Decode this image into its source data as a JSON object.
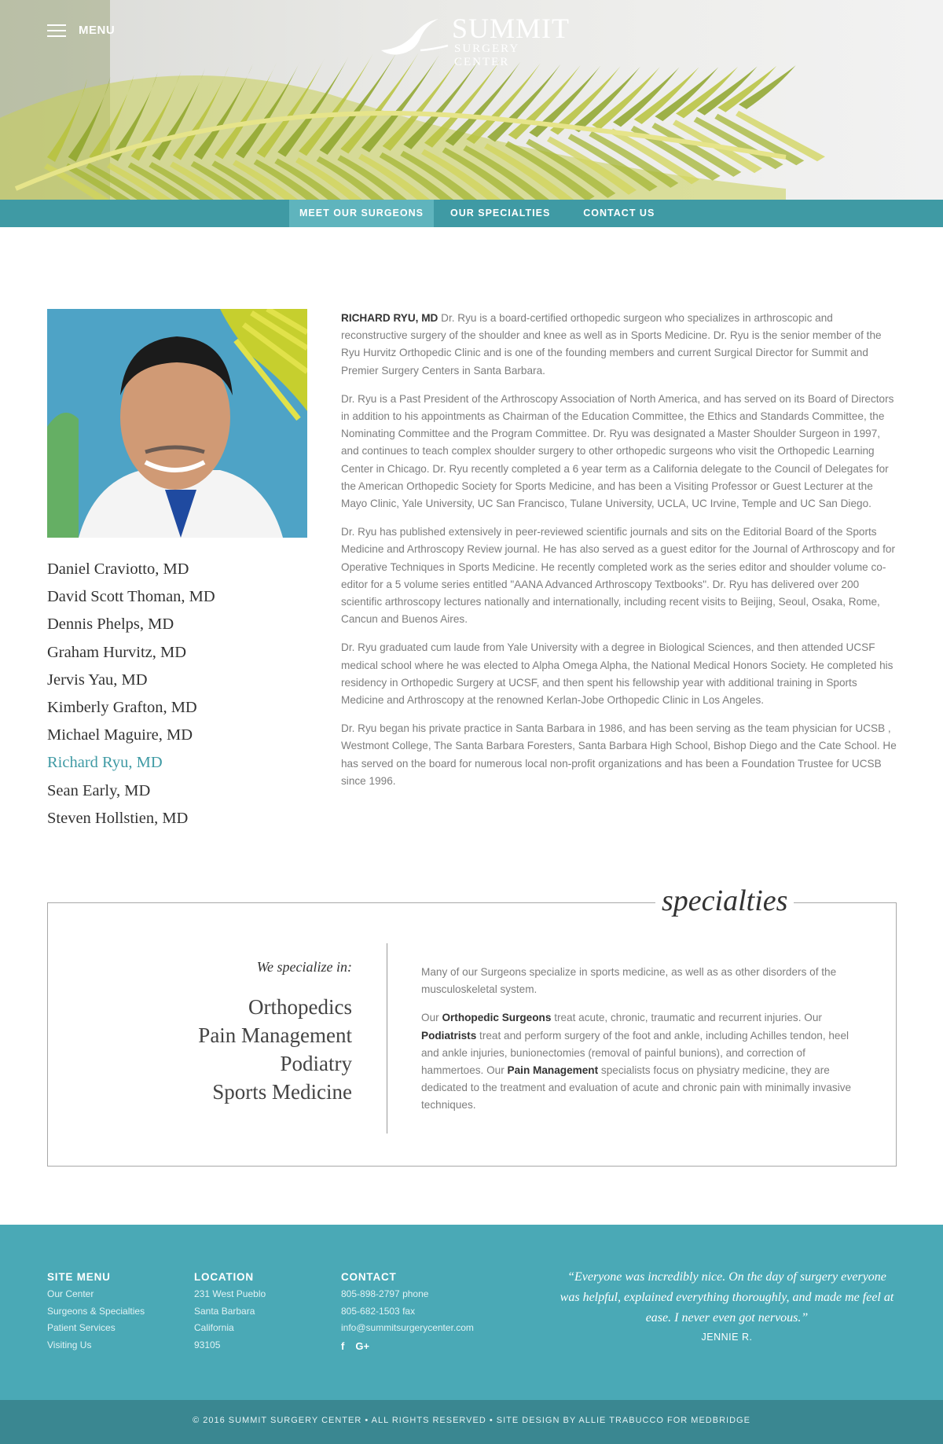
{
  "header": {
    "menu_label": "MENU",
    "logo_title": "SUMMIT",
    "logo_subtitle": "SURGERY CENTER"
  },
  "nav": {
    "items": [
      {
        "label": "MEET OUR SURGEONS",
        "active": true
      },
      {
        "label": "OUR SPECIALTIES",
        "active": false
      },
      {
        "label": "CONTACT US",
        "active": false
      }
    ]
  },
  "surgeons": {
    "list": [
      "Daniel Craviotto, MD",
      "David Scott Thoman, MD",
      "Dennis Phelps, MD",
      "Graham Hurvitz, MD",
      "Jervis Yau, MD",
      "Kimberly Grafton, MD",
      "Michael Maguire, MD",
      "Richard Ryu, MD",
      "Sean Early, MD",
      "Steven Hollstien, MD"
    ],
    "selected": "Richard Ryu, MD"
  },
  "bio": {
    "name": "RICHARD RYU, MD",
    "p1_rest": " Dr. Ryu is a board-certified orthopedic surgeon who specializes in arthroscopic and reconstructive surgery of the shoulder and knee as well as in Sports Medicine. Dr. Ryu is the senior member of the Ryu Hurvitz Orthopedic Clinic and is one of the founding members and current Surgical Director for Summit and Premier Surgery Centers in Santa Barbara.",
    "p2": "Dr. Ryu is a Past President of the Arthroscopy Association of North America, and has served on its Board of Directors in addition to his appointments as Chairman of the Education Committee, the Ethics and Standards Committee, the Nominating Committee and the Program Committee. Dr. Ryu was designated a Master Shoulder Surgeon in 1997, and continues to teach complex shoulder surgery to other orthopedic surgeons who visit the Orthopedic Learning Center in Chicago. Dr. Ryu recently completed a 6 year term as a California delegate to the Council of Delegates for the American Orthopedic Society for Sports Medicine, and has been a Visiting Professor or Guest Lecturer at the Mayo Clinic, Yale University, UC San Francisco, Tulane University, UCLA, UC Irvine, Temple and UC San Diego.",
    "p3": "Dr. Ryu has published extensively in peer-reviewed scientific journals and sits on the Editorial Board of the Sports Medicine and Arthroscopy Review journal. He has also served as a guest editor for the Journal of Arthroscopy and for Operative Techniques in Sports Medicine. He recently completed work as the series editor and shoulder volume co-editor for a 5 volume series entitled \"AANA Advanced Arthroscopy Textbooks\". Dr. Ryu has delivered over 200 scientific arthroscopy lectures nationally and internationally, including recent visits to Beijing, Seoul, Osaka, Rome, Cancun and Buenos Aires.",
    "p4": "Dr. Ryu graduated cum laude from Yale University with a degree in Biological Sciences, and then attended UCSF medical school where he was elected to Alpha Omega Alpha, the National Medical Honors Society. He completed his residency in Orthopedic Surgery at UCSF, and then spent his fellowship year with additional training in Sports Medicine and Arthroscopy at the renowned Kerlan-Jobe Orthopedic Clinic in Los Angeles.",
    "p5": "Dr. Ryu began his private practice in Santa Barbara in 1986, and has been serving as the team physician for UCSB , Westmont College, The Santa Barbara Foresters, Santa Barbara High School, Bishop Diego and the Cate School. He has served on the board for numerous local non-profit organizations and has been a Foundation Trustee for UCSB since 1996."
  },
  "specialties": {
    "heading": "specialties",
    "intro_label": "We specialize in:",
    "items": [
      "Orthopedics",
      "Pain Management",
      "Podiatry",
      "Sports Medicine"
    ],
    "p1": "Many of our Surgeons specialize in sports medicine, as well as as other disorders of the musculoskeletal system.",
    "p2_a": "Our ",
    "p2_b": "Orthopedic Surgeons",
    "p2_c": " treat acute, chronic, traumatic and recurrent injuries. Our ",
    "p2_d": "Podiatrists",
    "p2_e": " treat and perform surgery of the foot and ankle, including Achilles tendon, heel and ankle injuries, bunionectomies (removal of painful bunions), and correction of hammertoes. Our ",
    "p2_f": "Pain Management",
    "p2_g": " specialists focus on physiatry medicine, they are dedicated to the treatment and evaluation of acute and chronic pain with minimally invasive techniques."
  },
  "footer": {
    "site_menu": {
      "heading": "SITE MENU",
      "links": [
        "Our Center",
        "Surgeons & Specialties",
        "Patient Services",
        "Visiting Us"
      ]
    },
    "location": {
      "heading": "LOCATION",
      "lines": [
        "231 West Pueblo",
        "Santa Barbara",
        "California",
        "93105"
      ]
    },
    "contact": {
      "heading": "CONTACT",
      "lines": [
        "805-898-2797 phone",
        "805-682-1503 fax",
        "info@summitsurgerycenter.com"
      ],
      "social": [
        {
          "icon": "facebook-icon",
          "glyph": "f"
        },
        {
          "icon": "google-plus-icon",
          "glyph": "G+"
        }
      ]
    },
    "quote": "“Everyone was incredibly nice. On the day of surgery everyone was helpful, explained everything thoroughly, and made me feel at ease. I never even got nervous.”",
    "quote_author": "JENNIE R.",
    "copyright": "© 2016 SUMMIT SURGERY CENTER • ALL RIGHTS RESERVED • SITE DESIGN BY ALLIE TRABUCCO FOR MEDBRIDGE"
  },
  "colors": {
    "teal": "#3f9aa4",
    "teal_light": "#5fb4bd",
    "footer": "#4aa9b6",
    "footer_bottom": "#3a8791"
  }
}
